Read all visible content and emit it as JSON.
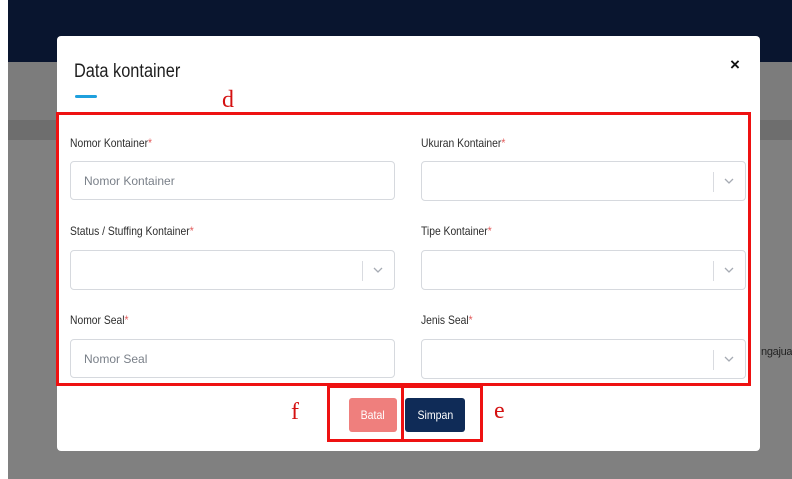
{
  "background": {
    "peek_text": "ngajua"
  },
  "modal": {
    "title": "Data kontainer",
    "close_label": "×",
    "fields": {
      "nomor_kontainer": {
        "label": "Nomor Kontainer",
        "placeholder": "Nomor Kontainer",
        "value": ""
      },
      "ukuran_kontainer": {
        "label": "Ukuran Kontainer",
        "selected": ""
      },
      "status_stuffing": {
        "label": "Status / Stuffing Kontainer",
        "selected": ""
      },
      "tipe_kontainer": {
        "label": "Tipe Kontainer",
        "selected": ""
      },
      "nomor_seal": {
        "label": "Nomor Seal",
        "placeholder": "Nomor Seal",
        "value": ""
      },
      "jenis_seal": {
        "label": "Jenis Seal",
        "selected": ""
      }
    },
    "required_mark": "*",
    "buttons": {
      "batal": "Batal",
      "simpan": "Simpan"
    }
  },
  "annotations": {
    "form_area": "d",
    "simpan_button": "e",
    "batal_button": "f"
  },
  "colors": {
    "header_navy": "#09152f",
    "overlay_gray": "#808080",
    "accent_blue": "#1fa0dd",
    "required_red": "#e35d5d",
    "batal_button": "#ef7f7d",
    "simpan_button": "#0f2b57",
    "annotation_red": "#ee1111"
  }
}
